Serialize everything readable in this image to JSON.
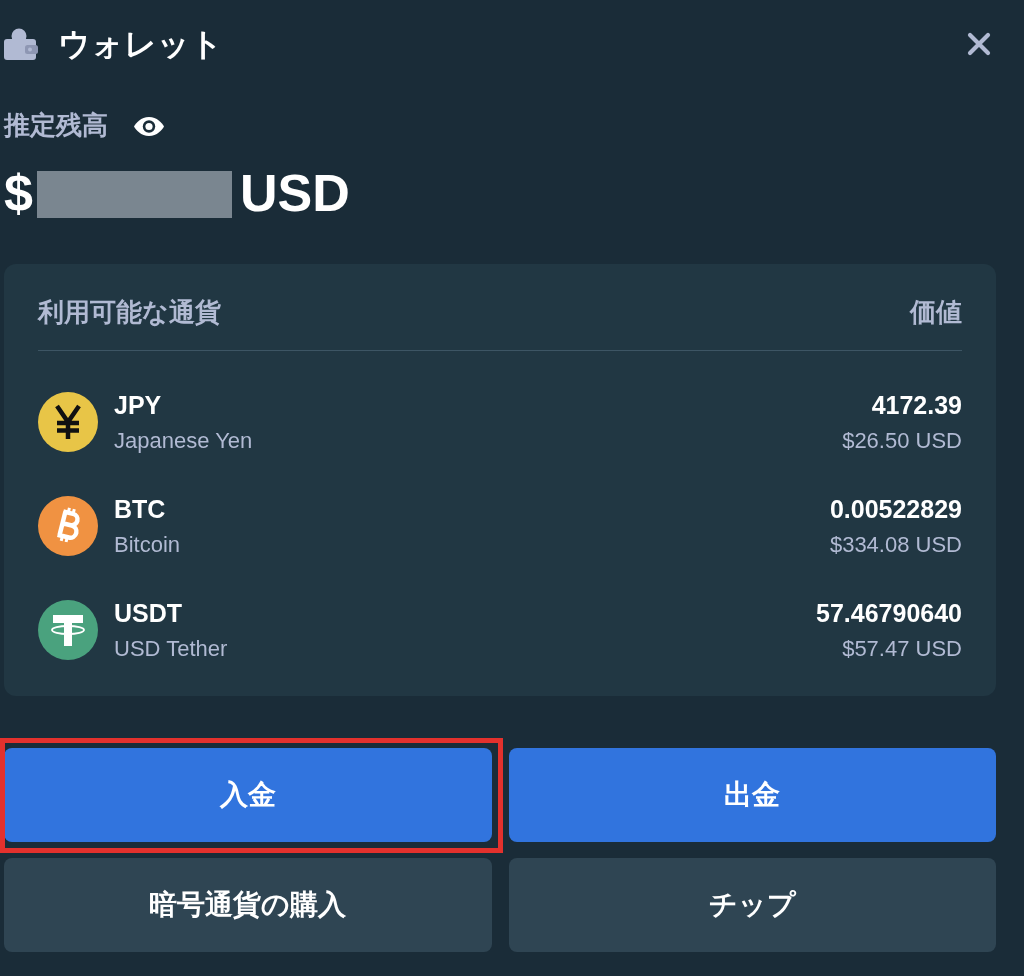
{
  "header": {
    "title": "ウォレット"
  },
  "balance": {
    "label": "推定残高",
    "symbol": "$",
    "redacted": true,
    "currency": "USD"
  },
  "currencies": {
    "columns": [
      "利用可能な通貨",
      "価値"
    ],
    "rows": [
      {
        "kind": "yen",
        "color": "#e8c547",
        "code": "JPY",
        "name": "Japanese Yen",
        "amount": "4172.39",
        "value": "$26.50 USD"
      },
      {
        "kind": "bitcoin",
        "color": "#f09242",
        "code": "BTC",
        "name": "Bitcoin",
        "amount": "0.00522829",
        "value": "$334.08 USD"
      },
      {
        "kind": "tether",
        "color": "#4aa27e",
        "code": "USDT",
        "name": "USD Tether",
        "amount": "57.46790640",
        "value": "$57.47 USD"
      }
    ]
  },
  "buttons": [
    {
      "label": "入金",
      "kind": "primary",
      "highlighted": true
    },
    {
      "label": "出金",
      "kind": "primary",
      "highlighted": false
    },
    {
      "label": "暗号通貨の購入",
      "kind": "secondary",
      "highlighted": false
    },
    {
      "label": "チップ",
      "kind": "secondary",
      "highlighted": false
    }
  ]
}
